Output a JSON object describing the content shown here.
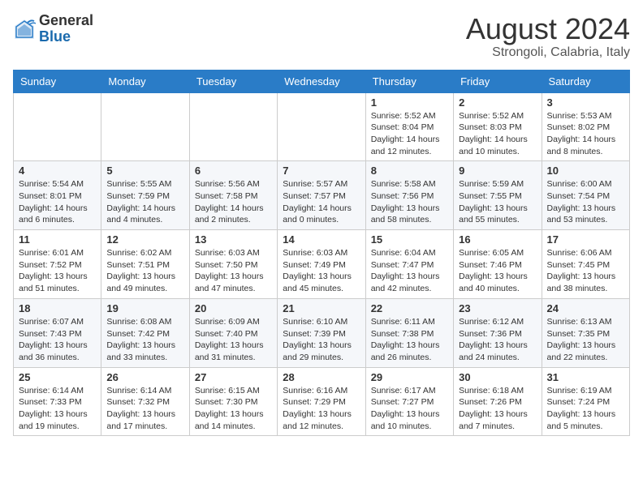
{
  "header": {
    "logo_general": "General",
    "logo_blue": "Blue",
    "month_year": "August 2024",
    "location": "Strongoli, Calabria, Italy"
  },
  "weekdays": [
    "Sunday",
    "Monday",
    "Tuesday",
    "Wednesday",
    "Thursday",
    "Friday",
    "Saturday"
  ],
  "weeks": [
    [
      {
        "day": "",
        "info": ""
      },
      {
        "day": "",
        "info": ""
      },
      {
        "day": "",
        "info": ""
      },
      {
        "day": "",
        "info": ""
      },
      {
        "day": "1",
        "info": "Sunrise: 5:52 AM\nSunset: 8:04 PM\nDaylight: 14 hours\nand 12 minutes."
      },
      {
        "day": "2",
        "info": "Sunrise: 5:52 AM\nSunset: 8:03 PM\nDaylight: 14 hours\nand 10 minutes."
      },
      {
        "day": "3",
        "info": "Sunrise: 5:53 AM\nSunset: 8:02 PM\nDaylight: 14 hours\nand 8 minutes."
      }
    ],
    [
      {
        "day": "4",
        "info": "Sunrise: 5:54 AM\nSunset: 8:01 PM\nDaylight: 14 hours\nand 6 minutes."
      },
      {
        "day": "5",
        "info": "Sunrise: 5:55 AM\nSunset: 7:59 PM\nDaylight: 14 hours\nand 4 minutes."
      },
      {
        "day": "6",
        "info": "Sunrise: 5:56 AM\nSunset: 7:58 PM\nDaylight: 14 hours\nand 2 minutes."
      },
      {
        "day": "7",
        "info": "Sunrise: 5:57 AM\nSunset: 7:57 PM\nDaylight: 14 hours\nand 0 minutes."
      },
      {
        "day": "8",
        "info": "Sunrise: 5:58 AM\nSunset: 7:56 PM\nDaylight: 13 hours\nand 58 minutes."
      },
      {
        "day": "9",
        "info": "Sunrise: 5:59 AM\nSunset: 7:55 PM\nDaylight: 13 hours\nand 55 minutes."
      },
      {
        "day": "10",
        "info": "Sunrise: 6:00 AM\nSunset: 7:54 PM\nDaylight: 13 hours\nand 53 minutes."
      }
    ],
    [
      {
        "day": "11",
        "info": "Sunrise: 6:01 AM\nSunset: 7:52 PM\nDaylight: 13 hours\nand 51 minutes."
      },
      {
        "day": "12",
        "info": "Sunrise: 6:02 AM\nSunset: 7:51 PM\nDaylight: 13 hours\nand 49 minutes."
      },
      {
        "day": "13",
        "info": "Sunrise: 6:03 AM\nSunset: 7:50 PM\nDaylight: 13 hours\nand 47 minutes."
      },
      {
        "day": "14",
        "info": "Sunrise: 6:03 AM\nSunset: 7:49 PM\nDaylight: 13 hours\nand 45 minutes."
      },
      {
        "day": "15",
        "info": "Sunrise: 6:04 AM\nSunset: 7:47 PM\nDaylight: 13 hours\nand 42 minutes."
      },
      {
        "day": "16",
        "info": "Sunrise: 6:05 AM\nSunset: 7:46 PM\nDaylight: 13 hours\nand 40 minutes."
      },
      {
        "day": "17",
        "info": "Sunrise: 6:06 AM\nSunset: 7:45 PM\nDaylight: 13 hours\nand 38 minutes."
      }
    ],
    [
      {
        "day": "18",
        "info": "Sunrise: 6:07 AM\nSunset: 7:43 PM\nDaylight: 13 hours\nand 36 minutes."
      },
      {
        "day": "19",
        "info": "Sunrise: 6:08 AM\nSunset: 7:42 PM\nDaylight: 13 hours\nand 33 minutes."
      },
      {
        "day": "20",
        "info": "Sunrise: 6:09 AM\nSunset: 7:40 PM\nDaylight: 13 hours\nand 31 minutes."
      },
      {
        "day": "21",
        "info": "Sunrise: 6:10 AM\nSunset: 7:39 PM\nDaylight: 13 hours\nand 29 minutes."
      },
      {
        "day": "22",
        "info": "Sunrise: 6:11 AM\nSunset: 7:38 PM\nDaylight: 13 hours\nand 26 minutes."
      },
      {
        "day": "23",
        "info": "Sunrise: 6:12 AM\nSunset: 7:36 PM\nDaylight: 13 hours\nand 24 minutes."
      },
      {
        "day": "24",
        "info": "Sunrise: 6:13 AM\nSunset: 7:35 PM\nDaylight: 13 hours\nand 22 minutes."
      }
    ],
    [
      {
        "day": "25",
        "info": "Sunrise: 6:14 AM\nSunset: 7:33 PM\nDaylight: 13 hours\nand 19 minutes."
      },
      {
        "day": "26",
        "info": "Sunrise: 6:14 AM\nSunset: 7:32 PM\nDaylight: 13 hours\nand 17 minutes."
      },
      {
        "day": "27",
        "info": "Sunrise: 6:15 AM\nSunset: 7:30 PM\nDaylight: 13 hours\nand 14 minutes."
      },
      {
        "day": "28",
        "info": "Sunrise: 6:16 AM\nSunset: 7:29 PM\nDaylight: 13 hours\nand 12 minutes."
      },
      {
        "day": "29",
        "info": "Sunrise: 6:17 AM\nSunset: 7:27 PM\nDaylight: 13 hours\nand 10 minutes."
      },
      {
        "day": "30",
        "info": "Sunrise: 6:18 AM\nSunset: 7:26 PM\nDaylight: 13 hours\nand 7 minutes."
      },
      {
        "day": "31",
        "info": "Sunrise: 6:19 AM\nSunset: 7:24 PM\nDaylight: 13 hours\nand 5 minutes."
      }
    ]
  ]
}
